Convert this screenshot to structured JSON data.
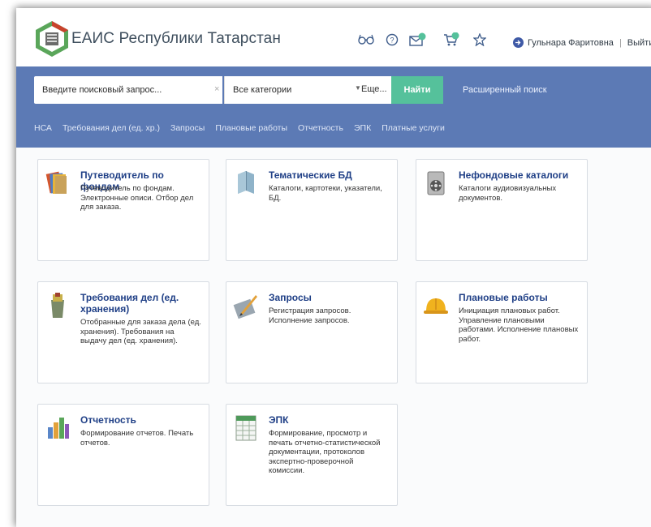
{
  "header": {
    "title": "ЕАИС Республики Татарстан",
    "user_name": "Гульнара Фаритовна",
    "separator": "|",
    "logout_label": "Выйти",
    "icons": [
      "glasses-icon",
      "help-icon",
      "mail-icon",
      "cart-icon",
      "star-icon",
      "user-avatar-icon"
    ],
    "mail_badge": "0",
    "cart_badge": "0"
  },
  "search": {
    "placeholder": "Введите поисковый запрос...",
    "clear": "×",
    "category": "Все категории",
    "more": "Еще...",
    "button": "Найти",
    "advanced": "Расширенный поиск"
  },
  "nav": [
    "НСА",
    "Требования дел (ед. хр.)",
    "Запросы",
    "Плановые работы",
    "Отчетность",
    "ЭПК",
    "Платные услуги"
  ],
  "cards": [
    {
      "title": "Путеводитель по фондам",
      "description": "Путеводитель по фондам. Электронные описи. Отбор дел для заказа.",
      "icon": "folders-icon"
    },
    {
      "title": "Тематические БД",
      "description": "Каталоги, картотеки, указатели, БД.",
      "icon": "book-icon"
    },
    {
      "title": "Нефондовые каталоги",
      "description": "Каталоги аудиовизуальных документов.",
      "icon": "film-reel-icon"
    },
    {
      "title": "Требования дел (ед. хранения)",
      "description": "Отобранные для заказа дела (ед. хранения). Требования на выдачу дел (ед. хранения).",
      "icon": "trash-basket-icon"
    },
    {
      "title": "Запросы",
      "description": "Регистрация запросов. Исполнение запросов.",
      "icon": "pencil-paper-icon"
    },
    {
      "title": "Плановые работы",
      "description": "Инициация плановых работ. Управление плановыми работами. Исполнение плановых работ.",
      "icon": "hard-hat-icon"
    },
    {
      "title": "Отчетность",
      "description": "Формирование отчетов. Печать отчетов.",
      "icon": "bar-chart-icon"
    },
    {
      "title": "ЭПК",
      "description": "Формирование, просмотр и печать отчетно-статистической документации, протоколов экспертно-проверочной комиссии.",
      "icon": "spreadsheet-icon"
    }
  ],
  "colors": {
    "band": "#5c7ab5",
    "find_button": "#55c19b",
    "card_title": "#1f3f86",
    "logo_green": "#5aa65a"
  }
}
